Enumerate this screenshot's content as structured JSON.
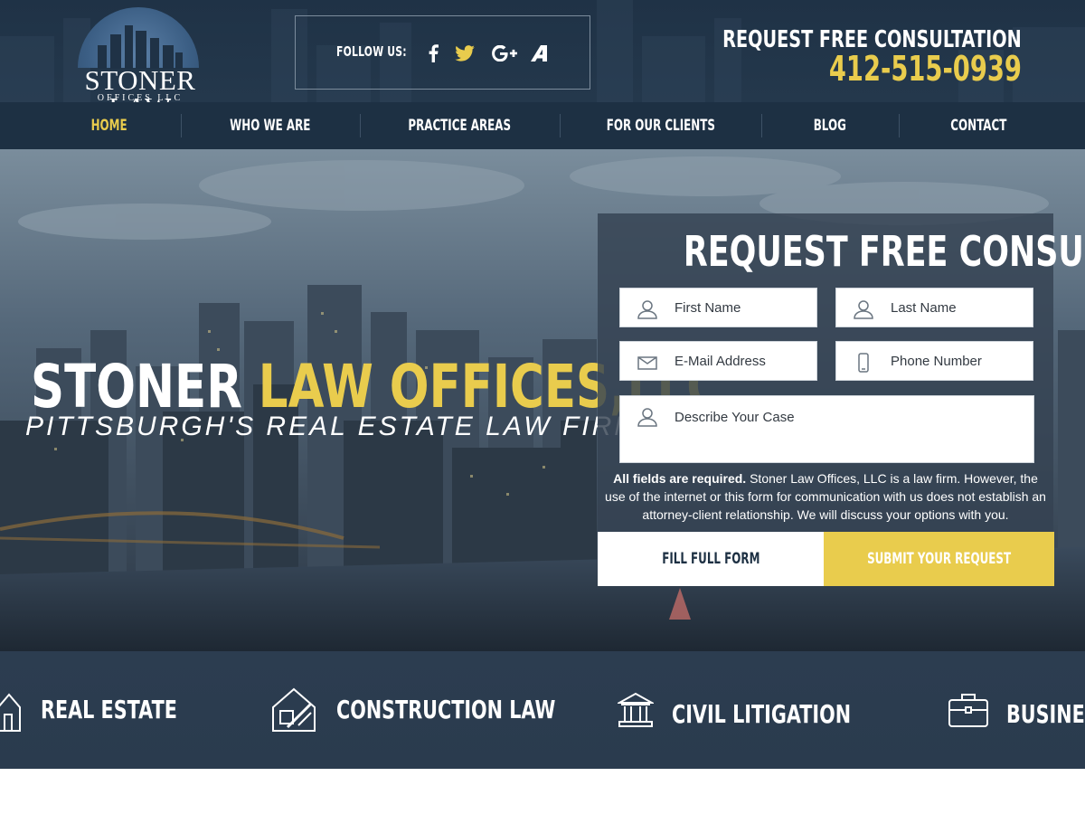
{
  "brand": {
    "name": "STONER LAW",
    "sub": "OFFICES LLC"
  },
  "follow": {
    "label": "FOLLOW US:",
    "icons": [
      "facebook-icon",
      "twitter-icon",
      "google-plus-icon",
      "avvo-icon"
    ]
  },
  "header": {
    "consult_label": "REQUEST FREE CONSULTATION",
    "phone": "412-515-0939"
  },
  "nav": {
    "items": [
      {
        "label": "HOME",
        "active": true
      },
      {
        "label": "WHO WE ARE"
      },
      {
        "label": "PRACTICE AREAS"
      },
      {
        "label": "FOR OUR CLIENTS"
      },
      {
        "label": "BLOG"
      },
      {
        "label": "CONTACT"
      }
    ]
  },
  "hero": {
    "title_white": "STONER ",
    "title_yellow": "LAW OFFICES,LLC",
    "subtitle": "PITTSBURGH'S REAL ESTATE LAW FIRM"
  },
  "form": {
    "title": "REQUEST FREE CONSULTATION",
    "first_name": "First Name",
    "last_name": "Last Name",
    "email": "E-Mail Address",
    "phone": "Phone Number",
    "case": "Describe Your Case",
    "disclaimer_bold": "All fields are required.",
    "disclaimer_text": " Stoner Law Offices, LLC is a law firm. However, the use of the internet or this form for communication with us does not establish an attorney-client relationship. We will discuss your options with you.",
    "fill_full": "FILL FULL FORM",
    "submit": "SUBMIT YOUR REQUEST"
  },
  "practice": {
    "items": [
      {
        "label": "REAL ESTATE",
        "icon": "house-icon"
      },
      {
        "label": "CONSTRUCTION LAW",
        "icon": "blueprint-icon"
      },
      {
        "label": "CIVIL LITIGATION",
        "icon": "courthouse-icon"
      },
      {
        "label": "BUSINESS",
        "icon": "briefcase-icon"
      }
    ]
  },
  "colors": {
    "accent": "#e9cc4d",
    "navy": "#1d3043",
    "panel": "#344252"
  }
}
